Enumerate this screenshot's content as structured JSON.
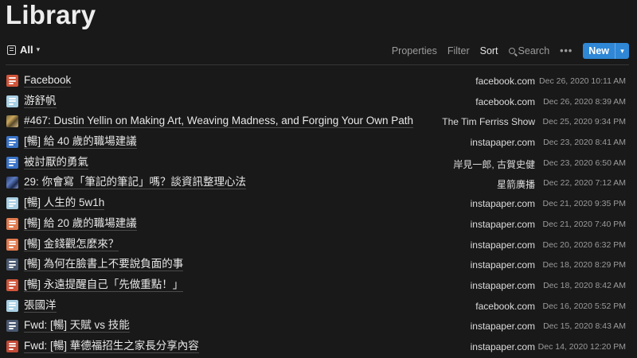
{
  "page": {
    "title": "Library"
  },
  "toolbar": {
    "view_label": "All",
    "properties_label": "Properties",
    "filter_label": "Filter",
    "sort_label": "Sort",
    "search_label": "Search",
    "more_label": "•••",
    "new_label": "New"
  },
  "colors": {
    "background": "#191919",
    "accent": "#2f87d6",
    "icon_red": "#d0553b",
    "icon_lightblue": "#a8cfe3",
    "icon_blue": "#3a73c8",
    "icon_slate": "#4b5a72",
    "icon_orange": "#e07a4f",
    "icon_darkred": "#c24a36"
  },
  "rows": [
    {
      "icon": "doc-red-icon",
      "color": "#d0553b",
      "title": "Facebook",
      "source": "facebook.com",
      "date": "Dec 26, 2020 10:11 AM"
    },
    {
      "icon": "doc-lightblue-icon",
      "color": "#a8cfe3",
      "title": "游舒帆",
      "source": "facebook.com",
      "date": "Dec 26, 2020 8:39 AM"
    },
    {
      "icon": "thumbnail-icon",
      "color": "",
      "title": "#467: Dustin Yellin on Making Art, Weaving Madness, and Forging Your Own Path",
      "source": "The Tim Ferriss Show",
      "date": "Dec 25, 2020 9:34 PM"
    },
    {
      "icon": "doc-blue-icon",
      "color": "#3a73c8",
      "title": "[暢] 給 40 歲的職場建議",
      "source": "instapaper.com",
      "date": "Dec 23, 2020 8:41 AM"
    },
    {
      "icon": "doc-blue-icon",
      "color": "#3a73c8",
      "title": "被討厭的勇氣",
      "source": "岸見一郎, 古賀史健",
      "date": "Dec 23, 2020 6:50 AM"
    },
    {
      "icon": "thumbnail-icon",
      "color": "",
      "title": "29: 你會寫「筆記的筆記」嗎？談資訊整理心法",
      "source": "星箭廣播",
      "date": "Dec 22, 2020 7:12 AM"
    },
    {
      "icon": "doc-lightblue-icon",
      "color": "#a8cfe3",
      "title": "[暢] 人生的 5w1h",
      "source": "instapaper.com",
      "date": "Dec 21, 2020 9:35 PM"
    },
    {
      "icon": "doc-orange-icon",
      "color": "#e07a4f",
      "title": "[暢] 給 20 歲的職場建議",
      "source": "instapaper.com",
      "date": "Dec 21, 2020 7:40 PM"
    },
    {
      "icon": "doc-orange-icon",
      "color": "#e07a4f",
      "title": "[暢] 金錢觀怎麼來？",
      "source": "instapaper.com",
      "date": "Dec 20, 2020 6:32 PM"
    },
    {
      "icon": "doc-slate-icon",
      "color": "#4b5a72",
      "title": "[暢] 為何在臉書上不要說負面的事",
      "source": "instapaper.com",
      "date": "Dec 18, 2020 8:29 PM"
    },
    {
      "icon": "doc-red-icon",
      "color": "#d0553b",
      "title": "[暢] 永遠提醒自己「先做重點！」",
      "source": "instapaper.com",
      "date": "Dec 18, 2020 8:42 AM"
    },
    {
      "icon": "doc-lightblue-icon",
      "color": "#a8cfe3",
      "title": "張國洋",
      "source": "facebook.com",
      "date": "Dec 16, 2020 5:52 PM"
    },
    {
      "icon": "doc-slate-icon",
      "color": "#4b5a72",
      "title": "Fwd: [暢] 天賦 vs 技能",
      "source": "instapaper.com",
      "date": "Dec 15, 2020 8:43 AM"
    },
    {
      "icon": "doc-darkred-icon",
      "color": "#c24a36",
      "title": "Fwd: [暢] 華德福招生之家長分享內容",
      "source": "instapaper.com",
      "date": "Dec 14, 2020 12:20 PM"
    }
  ]
}
